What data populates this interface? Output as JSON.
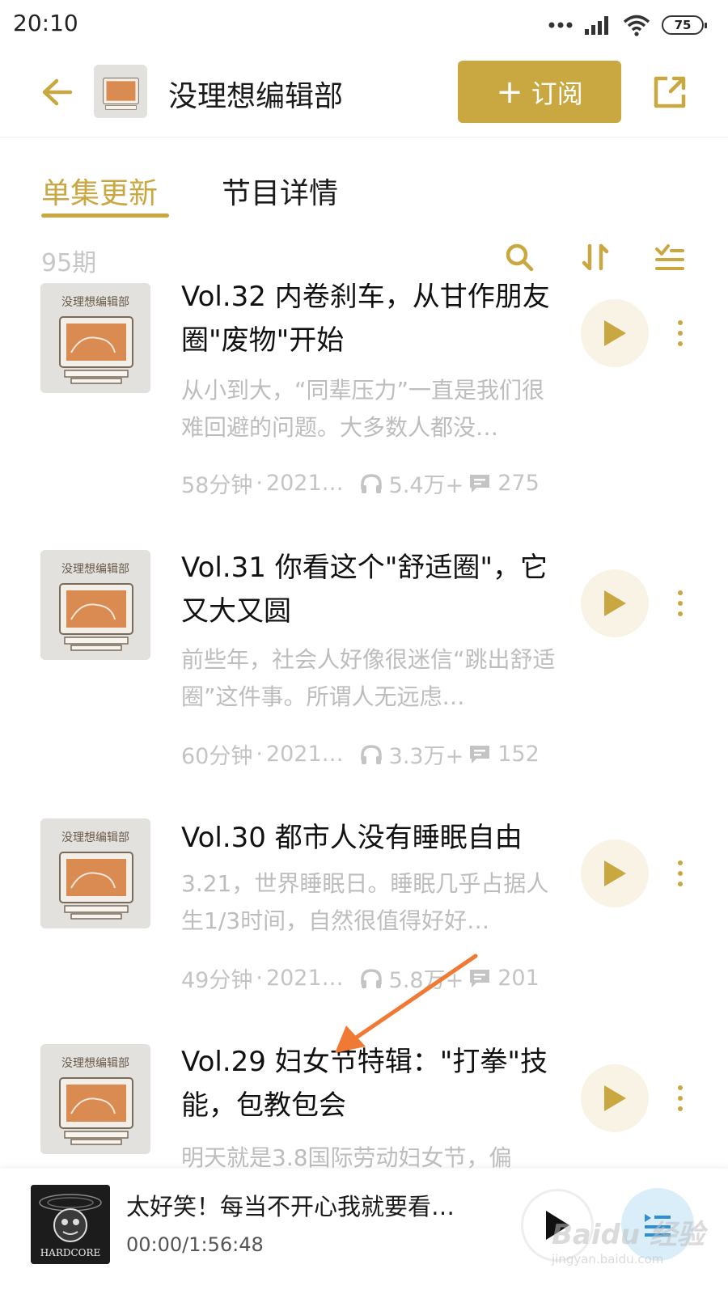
{
  "status_bar": {
    "time": "20:10",
    "battery": "75"
  },
  "header": {
    "title": "没理想编辑部",
    "subscribe_label": "订阅",
    "subscribe_plus": "+"
  },
  "tabs": [
    {
      "label": "单集更新",
      "active": true
    },
    {
      "label": "节目详情",
      "active": false
    }
  ],
  "toolbar": {
    "episode_count": "95期"
  },
  "cover_art_text": "没理想编辑部",
  "episodes": [
    {
      "title": "Vol.32 内卷刹车，从甘作朋友圈\"废物\"开始",
      "description": "从小到大，“同辈压力”一直是我们很难回避的问题。大多数人都没…",
      "duration": "58分钟",
      "date": "2021…",
      "plays": "5.4万+",
      "comments": "275"
    },
    {
      "title": "Vol.31 你看这个\"舒适圈\"，它又大又圆",
      "description": "前些年，社会人好像很迷信“跳出舒适圈”这件事。所谓人无远虑…",
      "duration": "60分钟",
      "date": "2021…",
      "plays": "3.3万+",
      "comments": "152"
    },
    {
      "title": "Vol.30 都市人没有睡眠自由",
      "description": "3.21，世界睡眠日。睡眠几乎占据人生1/3时间，自然很值得好好…",
      "duration": "49分钟",
      "date": "2021…",
      "plays": "5.8万+",
      "comments": "201"
    },
    {
      "title": "Vol.29 妇女节特辑：\"打拳\"技能，包教包会",
      "description": "明天就是3.8国际劳动妇女节，偏",
      "duration": "",
      "date": "",
      "plays": "",
      "comments": ""
    }
  ],
  "mini_player": {
    "title": "太好笑！每当不开心我就要看…",
    "time": "00:00/1:56:48",
    "cover_text": "HARDCORE"
  },
  "watermark": {
    "main": "Baidu 经验",
    "sub": "jingyan.baidu.com"
  },
  "colors": {
    "accent": "#c9a741",
    "annotation_arrow": "#f07a33",
    "play_bg": "#f8f3e4"
  }
}
